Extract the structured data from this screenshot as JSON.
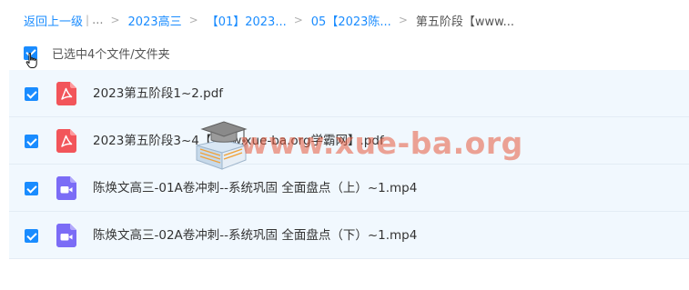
{
  "breadcrumb": {
    "back_label": "返回上一级",
    "pipe": "|",
    "ellipsis": "...",
    "separator": ">",
    "items": [
      {
        "label": "2023高三"
      },
      {
        "label": "【01】2023..."
      },
      {
        "label": "05【2023陈..."
      }
    ],
    "current": "第五阶段【www..."
  },
  "selection": {
    "label": "已选中4个文件/文件夹",
    "all_checked": true
  },
  "files": [
    {
      "name": "2023第五阶段1~2.pdf",
      "type": "pdf",
      "checked": true,
      "icon": "pdf-file-icon"
    },
    {
      "name": "2023第五阶段3~4【www.xue-ba.org学霸网】.pdf",
      "type": "pdf",
      "checked": true,
      "icon": "pdf-file-icon"
    },
    {
      "name": "陈焕文高三-01A卷冲刺--系统巩固 全面盘点（上）~1.mp4",
      "type": "video",
      "checked": true,
      "icon": "video-file-icon"
    },
    {
      "name": "陈焕文高三-02A卷冲刺--系统巩固 全面盘点（下）~1.mp4",
      "type": "video",
      "checked": true,
      "icon": "video-file-icon"
    }
  ],
  "watermark": {
    "text": "www.xue-ba.org"
  },
  "colors": {
    "accent": "#1a8cff",
    "pdf_red": "#f2555a",
    "video_purple": "#7b6cf6",
    "row_selected_bg": "#f1f8fe"
  }
}
